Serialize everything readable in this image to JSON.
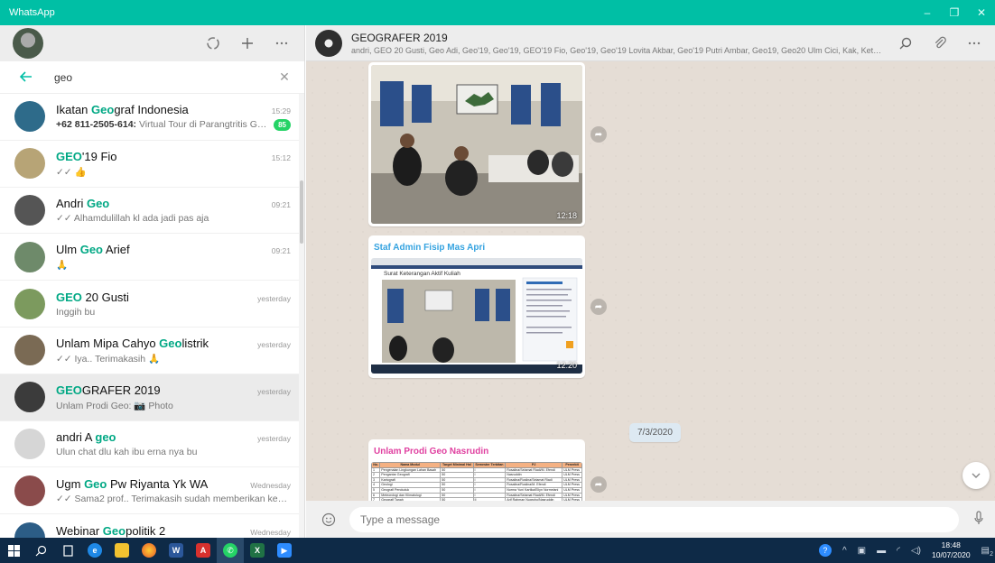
{
  "window": {
    "title": "WhatsApp",
    "controls": [
      "–",
      "❐",
      "✕"
    ]
  },
  "sidebar": {
    "header_icons": {
      "status": "status-icon",
      "new_chat": "plus-icon",
      "menu": "more-icon"
    },
    "search": {
      "value": "geo",
      "placeholder": "Search or start new chat"
    },
    "chats": [
      {
        "name_pre": "Ikatan ",
        "name_hl": "Geo",
        "name_post": "graf Indonesia",
        "time": "15:29",
        "preview_bold": "+62 811-2505-614:",
        "preview": " Virtual Tour di Parangtritis Ge...",
        "badge": "85",
        "avatar": "#2e6b8a"
      },
      {
        "name_pre": "",
        "name_hl": "GEO",
        "name_post": "'19 Fio",
        "time": "15:12",
        "preview_bold": "",
        "preview": "✓✓ 👍",
        "badge": "",
        "avatar": "#b7a476"
      },
      {
        "name_pre": "Andri ",
        "name_hl": "Geo",
        "name_post": "",
        "time": "09:21",
        "preview_bold": "",
        "preview": "✓✓ Alhamdulillah kl ada jadi pas aja",
        "badge": "",
        "avatar": "#555555"
      },
      {
        "name_pre": "Ulm ",
        "name_hl": "Geo",
        "name_post": " Arief",
        "time": "09:21",
        "preview_bold": "",
        "preview": "🙏",
        "badge": "",
        "avatar": "#6e8a6a"
      },
      {
        "name_pre": "",
        "name_hl": "GEO",
        "name_post": " 20 Gusti",
        "time": "yesterday",
        "preview_bold": "",
        "preview": "Inggih bu",
        "badge": "",
        "avatar": "#7c9a5e"
      },
      {
        "name_pre": "Unlam Mipa Cahyo ",
        "name_hl": "Geo",
        "name_post": "listrik",
        "time": "yesterday",
        "preview_bold": "",
        "preview": "✓✓ Iya.. Terimakasih 🙏",
        "badge": "",
        "avatar": "#7a6a54"
      },
      {
        "name_pre": "",
        "name_hl": "GEO",
        "name_post": "GRAFER 2019",
        "time": "yesterday",
        "preview_bold": "",
        "preview": "Unlam Prodi Geo: 📷 Photo",
        "badge": "",
        "avatar": "#3b3b3b",
        "selected": true
      },
      {
        "name_pre": "andri A ",
        "name_hl": "geo",
        "name_post": "",
        "time": "yesterday",
        "preview_bold": "",
        "preview": "Ulun chat dlu kah ibu erna nya bu",
        "badge": "",
        "avatar": "#d6d6d6"
      },
      {
        "name_pre": "Ugm ",
        "name_hl": "Geo",
        "name_post": " Pw Riyanta Yk WA",
        "time": "Wednesday",
        "preview_bold": "",
        "preview": "✓✓ Sama2 prof.. Terimakasih sudah memberikan kesem...",
        "badge": "",
        "avatar": "#8a4b4b"
      },
      {
        "name_pre": "Webinar ",
        "name_hl": "Geo",
        "name_post": "politik 2",
        "time": "Wednesday",
        "preview_bold": "",
        "preview": "+62 853-4055-7039 left",
        "badge": "",
        "avatar": "#2c5d86"
      }
    ]
  },
  "conversation": {
    "name": "GEOGRAFER 2019",
    "members": "andri, GEO 20 Gusti, Geo Adi, Geo'19, Geo'19, GEO'19 Fio, Geo'19, Geo'19 Lovita Akbar, Geo'19 Putri Ambar, Geo19, Geo20 Ulm Cici, Kak, Ketua...",
    "header_icons": {
      "search": "search-icon",
      "attach": "paperclip-icon",
      "menu": "more-icon"
    },
    "messages": [
      {
        "sender": "",
        "time": "12:18"
      },
      {
        "sender": "Staf Admin Fisip Mas Apri",
        "sender_color": "#35a3e0",
        "time": "12:20",
        "doc_title": "Surat Keterangan Aktif Kuliah"
      },
      {
        "sender": "Unlam Prodi Geo Nasrudin",
        "sender_color": "#e040a0",
        "time": ""
      }
    ],
    "date_chip": "7/3/2020",
    "composer": {
      "placeholder": "Type a message"
    }
  },
  "table": {
    "headers": [
      "No.",
      "Nama Modul",
      "Target Minimal Hal",
      "Semester Terbitan",
      "PJ",
      "Penerbit"
    ],
    "rows": [
      [
        "1",
        "Pengenalan Lingkungan Lahan Basah",
        "50",
        "I",
        "Rosalina/Selamat Riadi/M. Efendi",
        "ULM Press"
      ],
      [
        "2",
        "Pengantar Geografi",
        "50",
        "I",
        "Nasruddin",
        "ULM Press"
      ],
      [
        "3",
        "Kartografi",
        "50",
        "I",
        "Rosalina/Ruslina/Selamat Riadi",
        "ULM Press"
      ],
      [
        "4",
        "Geologi",
        "50",
        "I",
        "Rosalina/Ruslina/M. Efendi",
        "ULM Press"
      ],
      [
        "5",
        "Geografi Penduduk",
        "50",
        "I",
        "Norma Yuni Kartika/Eliyn Normelani",
        "ULM Press"
      ],
      [
        "6",
        "Meteorologi dan Klimatologi",
        "50",
        "I",
        "Rosalina/Selamat Riadi/M. Efendi",
        "ULM Press"
      ],
      [
        "7",
        "Geografi Tanah",
        "50",
        "II",
        "Arif Rahman Nugroho/Nasruddin",
        "ULM Press"
      ],
      [
        "8",
        "Geomorfologi",
        "50",
        "II",
        "Arif Rahman Nugroho/Nasruddin",
        "ULM Press"
      ],
      [
        "9",
        "Hidrologi",
        "50",
        "II",
        "Rosalina/Eliyn Normelani",
        "ULM Press"
      ],
      [
        "10",
        "Oseanografi",
        "50",
        "II",
        "Nasruddin/Rosalina/Puspita Dewi",
        "ULM Press"
      ]
    ]
  },
  "taskbar": {
    "apps": [
      "windows",
      "search",
      "task-view",
      "edge",
      "explorer",
      "firefox",
      "word",
      "acrobat",
      "whatsapp",
      "excel",
      "zoom"
    ],
    "clock_time": "18:48",
    "clock_date": "10/07/2020",
    "notif_count": "2"
  }
}
